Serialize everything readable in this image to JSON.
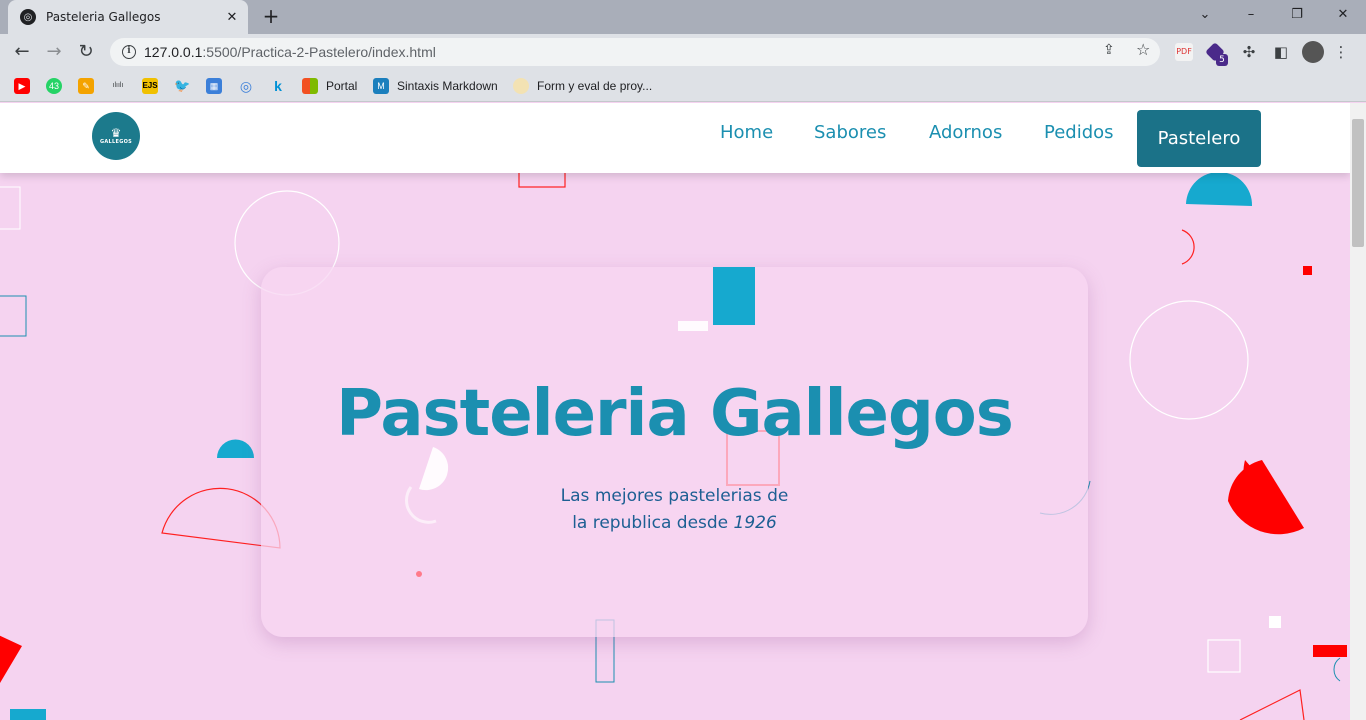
{
  "browser": {
    "tab_title": "Pasteleria Gallegos",
    "url_host": "127.0.0.1",
    "url_rest": ":5500/Practica-2-Pastelero/index.html",
    "extension_badge": "5",
    "bookmarks": [
      {
        "label": "",
        "icon": "youtube-icon",
        "color": "#ff0000"
      },
      {
        "label": "",
        "icon": "whatsapp-icon",
        "color": "#25d366"
      },
      {
        "label": "",
        "icon": "pencil-icon",
        "color": "#f4a300"
      },
      {
        "label": "",
        "icon": "cisco-icon",
        "color": "#5f6368"
      },
      {
        "label": "",
        "icon": "ejs-icon",
        "color": "#f0c000"
      },
      {
        "label": "",
        "icon": "twitter-icon",
        "color": "#1da1f2"
      },
      {
        "label": "",
        "icon": "app-icon",
        "color": "#3b7fd9"
      },
      {
        "label": "",
        "icon": "globe-icon",
        "color": "#3b7fd9"
      },
      {
        "label": "",
        "icon": "k-icon",
        "color": "#0091d5"
      },
      {
        "label": "Portal",
        "icon": "microsoft-icon",
        "color": "#f25022"
      },
      {
        "label": "Sintaxis Markdown",
        "icon": "markdown-icon",
        "color": "#1b7fbd"
      },
      {
        "label": "Form y eval de proy...",
        "icon": "document-icon",
        "color": "#e8c36a"
      }
    ]
  },
  "nav": {
    "items": [
      "Home",
      "Sabores",
      "Adornos",
      "Pedidos"
    ],
    "active": "Pastelero",
    "logo_text": "GALLEGOS"
  },
  "hero": {
    "title": "Pasteleria Gallegos",
    "subtitle_line1": "Las mejores pastelerias de",
    "subtitle_line2": "la republica desde",
    "year": "1926"
  },
  "colors": {
    "background": "#f5d3f0",
    "brand_teal": "#1b8fb0",
    "active_button": "#1b7288",
    "subtitle": "#1d5f93",
    "accent_red": "#ff0000"
  }
}
